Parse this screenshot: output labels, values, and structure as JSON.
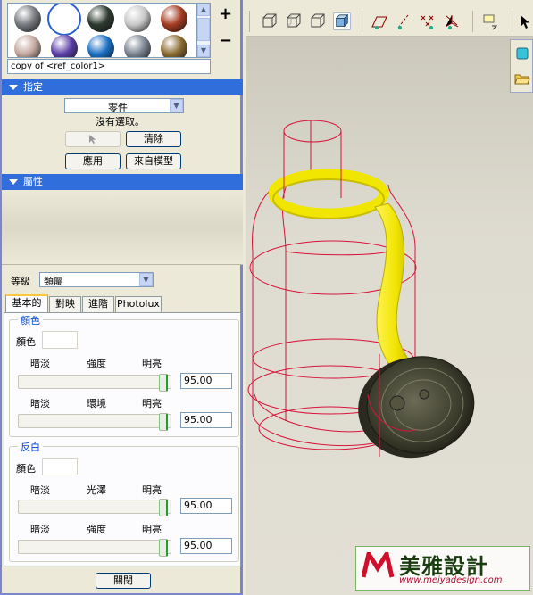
{
  "material_library": {
    "swatches": [
      {
        "name": "gray-metal-swatch",
        "color": "#777a7f"
      },
      {
        "name": "white-swatch",
        "color": "#ffffff",
        "selected": true
      },
      {
        "name": "dark-green-swatch",
        "color": "#2d3a30"
      },
      {
        "name": "silver-swatch",
        "color": "#c9c9c9"
      },
      {
        "name": "brick-swatch",
        "color": "#a53c22"
      },
      {
        "name": "grid-swatch",
        "color": "#c4a8a0"
      },
      {
        "name": "purple-swatch",
        "color": "#5c3fa8"
      },
      {
        "name": "blue-swatch",
        "color": "#1a6fc4"
      },
      {
        "name": "steel-swatch",
        "color": "#7a8491"
      },
      {
        "name": "bronze-swatch",
        "color": "#8a6a32"
      }
    ],
    "add_label": "+",
    "remove_label": "−",
    "name_value": "copy of <ref_color1>"
  },
  "assign_section": {
    "title": "指定",
    "scope_select": "零件",
    "status": "沒有選取。",
    "clear_button": "清除",
    "apply_button": "應用",
    "from_model_button": "來自模型"
  },
  "properties_section": {
    "title": "屬性"
  },
  "class_row": {
    "label": "等級",
    "value": "類屬"
  },
  "tabs": [
    "基本的",
    "對映",
    "進階",
    "Photolux"
  ],
  "color_group": {
    "title": "顏色",
    "color_label": "顏色",
    "row1": {
      "left": "暗淡",
      "mid": "強度",
      "right": "明亮",
      "value": "95.00",
      "level": 0.95
    },
    "row2": {
      "left": "暗淡",
      "mid": "環境",
      "right": "明亮",
      "value": "95.00",
      "level": 0.95
    }
  },
  "highlight_group": {
    "title": "反白",
    "color_label": "顏色",
    "row1": {
      "left": "暗淡",
      "mid": "光澤",
      "right": "明亮",
      "value": "95.00",
      "level": 0.95
    },
    "row2": {
      "left": "暗淡",
      "mid": "強度",
      "right": "明亮",
      "value": "95.00",
      "level": 0.95
    }
  },
  "close_button": "關閉",
  "viewport": {
    "toolbar_icons": [
      "wireframe-view-icon",
      "hidden-line-icon",
      "no-hidden-icon",
      "shaded-view-icon",
      "datum-plane-icon",
      "datum-axis-icon",
      "datum-point-icon",
      "coordinate-system-icon",
      "annotation-icon",
      "select-arrow-icon"
    ],
    "colors": {
      "wire": "#d8143a",
      "yellow": "#f0e600",
      "cap": "#4a4a38"
    }
  },
  "watermark": {
    "brand": "美雅設計",
    "url": "www.meiyadesign.com"
  }
}
